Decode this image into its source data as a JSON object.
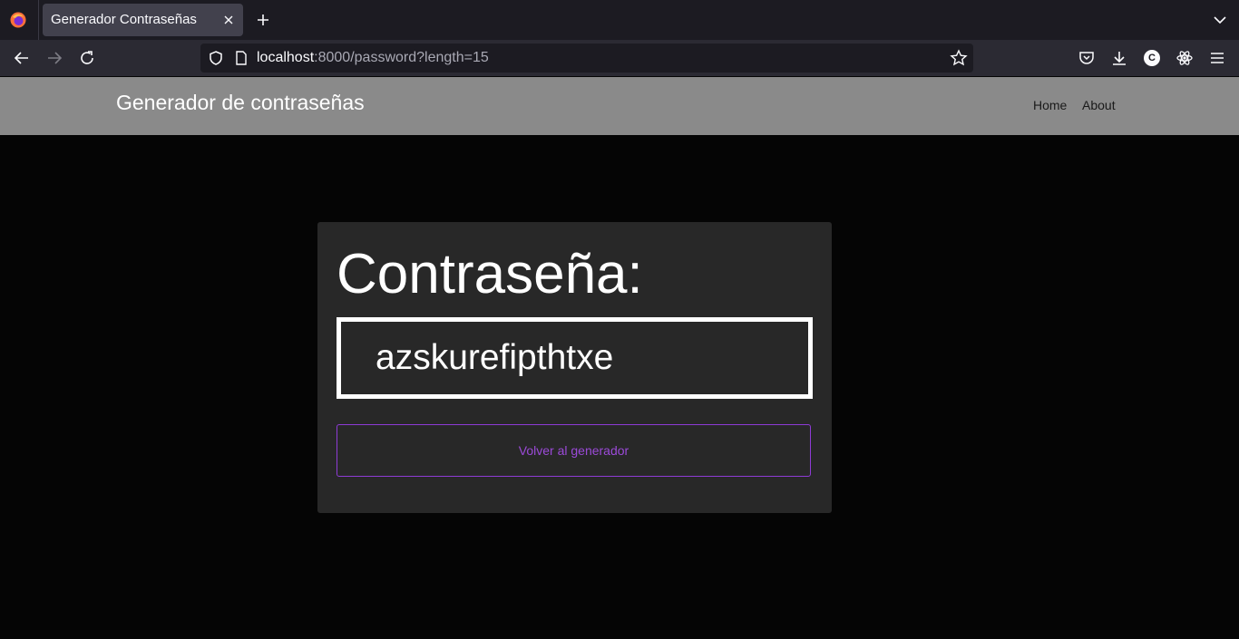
{
  "browser": {
    "tab_title": "Generador Contraseñas",
    "url_host": "localhost",
    "url_rest": ":8000/password?length=15",
    "account_initial": "C"
  },
  "header": {
    "brand": "Generador de contraseñas",
    "nav": [
      {
        "label": "Home"
      },
      {
        "label": "About"
      }
    ]
  },
  "card": {
    "title": "Contraseña:",
    "password": "azskurefipthtxe",
    "back_button": "Volver al generador"
  },
  "colors": {
    "accent": "#9b4ad8",
    "header_bg": "#8a8a8a",
    "card_bg": "#282828",
    "page_bg": "#050505"
  }
}
